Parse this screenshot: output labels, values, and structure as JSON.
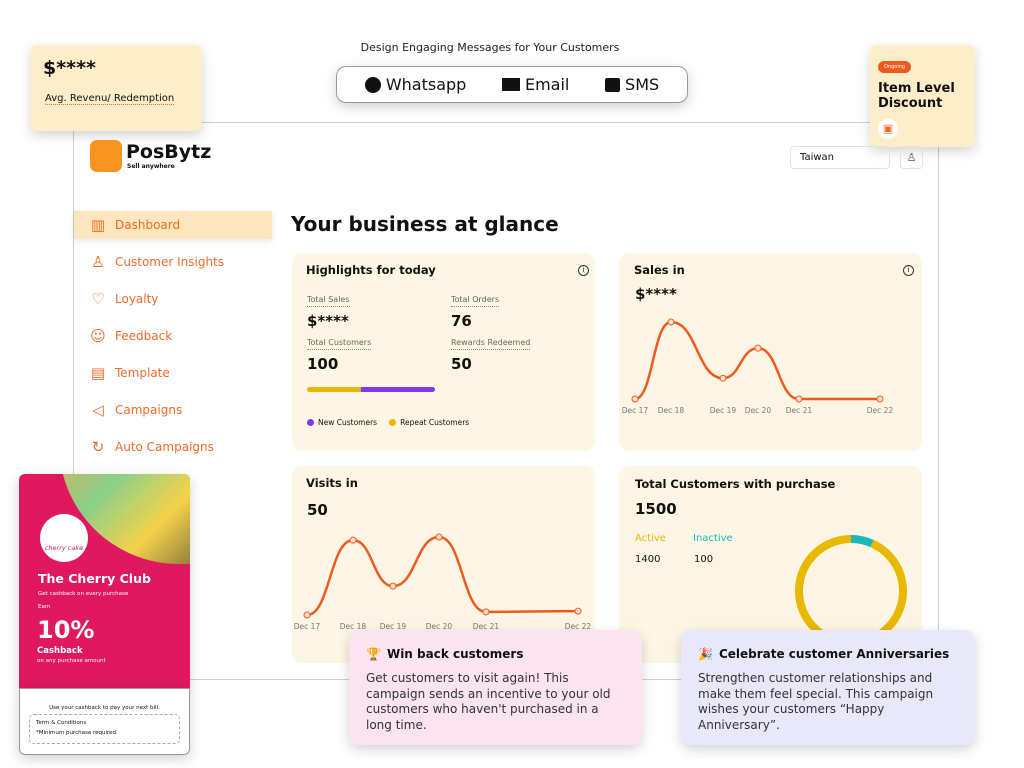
{
  "top": {
    "heading": "Design Engaging Messages for Your Customers",
    "channels": [
      {
        "label": "Whatsapp",
        "icon": "whatsapp-icon"
      },
      {
        "label": "Email",
        "icon": "mail-icon"
      },
      {
        "label": "SMS",
        "icon": "sms-icon"
      }
    ]
  },
  "avg_card": {
    "value": "$****",
    "label": "Avg. Revenu/ Redemption"
  },
  "discount_card": {
    "badge": "Ongoing",
    "title": "Item Level Discount",
    "icon": "gift-icon"
  },
  "brand": {
    "name": "PosBytz",
    "tagline": "Sell anywhere"
  },
  "header": {
    "country": "Taiwan",
    "user_icon": "user-icon"
  },
  "sidebar": {
    "items": [
      {
        "label": "Dashboard",
        "icon": "chart-icon",
        "active": true
      },
      {
        "label": "Customer Insights",
        "icon": "user-icon"
      },
      {
        "label": "Loyalty",
        "icon": "heart-icon"
      },
      {
        "label": "Feedback",
        "icon": "smile-icon"
      },
      {
        "label": "Template",
        "icon": "document-icon"
      },
      {
        "label": "Campaigns",
        "icon": "megaphone-icon"
      },
      {
        "label": "Auto Campaigns",
        "icon": "refresh-icon"
      }
    ]
  },
  "main": {
    "title": "Your business at glance",
    "highlights": {
      "title": "Highlights for today",
      "total_sales_label": "Total Sales",
      "total_sales": "$****",
      "total_orders_label": "Total Orders",
      "total_orders": "76",
      "total_customers_label": "Total Customers",
      "total_customers": "100",
      "rewards_label": "Rewards Redeemed",
      "rewards": "50",
      "new_share": 0.58,
      "legend_new": "New Customers",
      "legend_repeat": "Repeat Customers",
      "new_color": "#7c3aed",
      "repeat_color": "#e9b800"
    },
    "sales": {
      "title": "Sales in",
      "value": "$****"
    },
    "visits": {
      "title": "Visits in",
      "value": "50"
    },
    "customers": {
      "title": "Total Customers with purchase",
      "value": "1500",
      "active_label": "Active",
      "active": "1400",
      "inactive_label": "Inactive",
      "inactive": "100"
    }
  },
  "chart_data": [
    {
      "type": "line",
      "title": "Sales in",
      "categories": [
        "Dec 17",
        "Dec 18",
        "Dec 19",
        "Dec 20",
        "Dec 21",
        "Dec 22"
      ],
      "values": [
        0,
        1.0,
        0.27,
        0.66,
        0,
        0
      ],
      "color": "#f05a22",
      "grid": false
    },
    {
      "type": "line",
      "title": "Visits in",
      "categories": [
        "Dec 17",
        "Dec 18",
        "Dec 19",
        "Dec 20",
        "Dec 21",
        "Dec 22"
      ],
      "values": [
        0,
        0.96,
        0.37,
        1.0,
        0.04,
        0.05
      ],
      "color": "#f05a22",
      "grid": false
    },
    {
      "type": "pie",
      "title": "Total Customers with purchase",
      "categories": [
        "Active",
        "Inactive"
      ],
      "values": [
        1400,
        100
      ],
      "colors": [
        "#e9b800",
        "#1ab8b8"
      ]
    }
  ],
  "cherry": {
    "logo_text": "cherry cake",
    "title": "The Cherry Club",
    "subtitle": "Get cashback on every purchase",
    "earn": "Earn",
    "percent": "10%",
    "cashback": "Cashback",
    "cashback_sub": "on any purchase amount",
    "footer": "Use your cashback to pay your next bill.",
    "terms_title": "Term & Conditions",
    "terms": "*Minimum purchase required."
  },
  "promos": [
    {
      "title": "Win back customers",
      "icon": "trophy-icon",
      "emoji": "🏆",
      "text": "Get customers to visit again! This campaign sends an incentive to your old customers who haven't purchased in a long time."
    },
    {
      "title": "Celebrate customer Anniversaries",
      "icon": "party-icon",
      "emoji": "🎉",
      "text": "Strengthen customer relationships and make them feel special. This campaign wishes your customers “Happy Anniversary”."
    }
  ]
}
